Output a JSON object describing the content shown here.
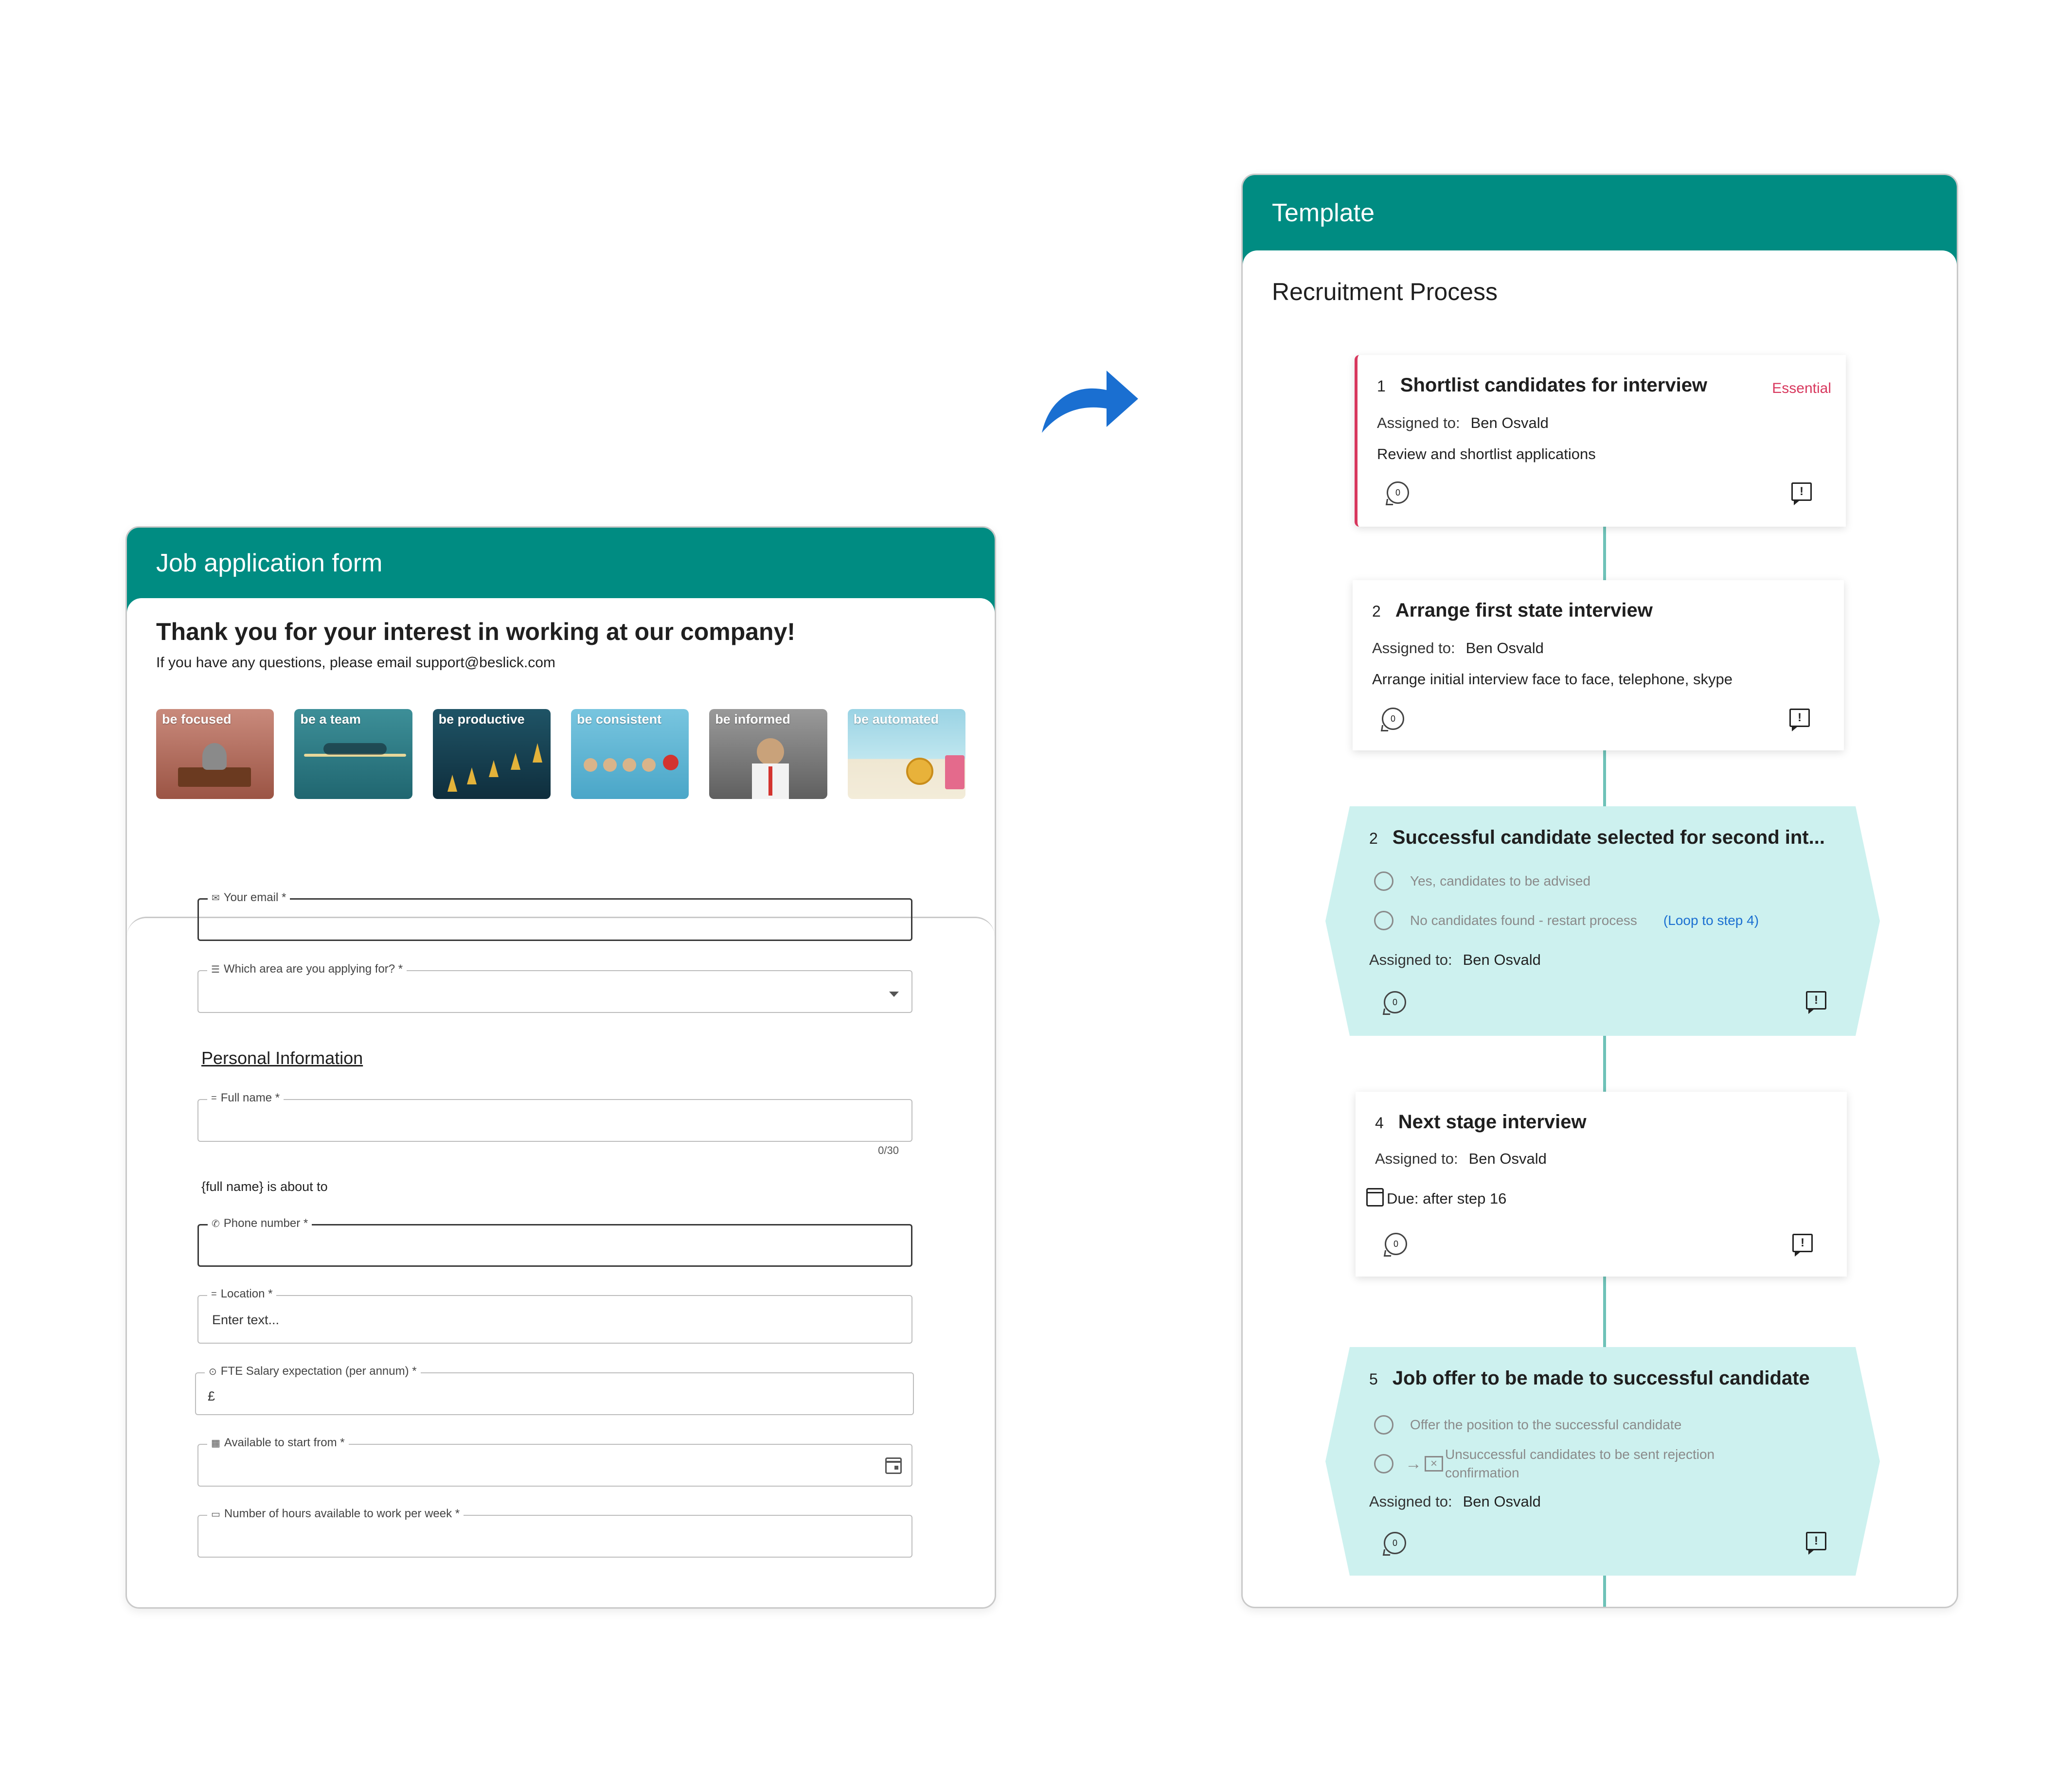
{
  "form": {
    "header": "Job application form",
    "intro_title": "Thank you for your interest in working at our company!",
    "intro_sub": "If you have any questions, please email support@beslick.com",
    "tiles": [
      {
        "label": "be focused",
        "color": "#b56a5c"
      },
      {
        "label": "be a team",
        "color": "#2d7c86"
      },
      {
        "label": "be productive",
        "color": "#153f52"
      },
      {
        "label": "be consistent",
        "color": "#5ab3d2"
      },
      {
        "label": "be informed",
        "color": "#7f7f7f"
      },
      {
        "label": "be automated",
        "color": "#9ad3e4"
      }
    ],
    "fields": {
      "email_label": "Your email *",
      "area_label": "Which area are you applying for? *",
      "personal_heading": "Personal Information",
      "fullname_label": "Full name *",
      "fullname_counter": "0/30",
      "helper_text": "{full name} is about to",
      "phone_label": "Phone number *",
      "location_label": "Location *",
      "location_placeholder": "Enter text...",
      "salary_label": "FTE Salary expectation (per annum) *",
      "salary_value": "£",
      "start_label": "Available to start from *",
      "hours_label": "Number of hours available to work per week *"
    }
  },
  "template": {
    "header": "Template",
    "process_title": "Recruitment Process",
    "assigned_label": "Assigned to:",
    "steps": [
      {
        "num": "1",
        "title": "Shortlist candidates for interview",
        "badge": "Essential",
        "assignee": "Ben Osvald",
        "desc": "Review and shortlist applications",
        "comments": "0"
      },
      {
        "num": "2",
        "title": "Arrange first state interview",
        "assignee": "Ben Osvald",
        "desc": "Arrange initial interview face to face, telephone, skype",
        "comments": "0"
      },
      {
        "num": "2",
        "title": "Successful candidate selected for second int...",
        "options": [
          "Yes, candidates to be advised",
          "No candidates found - restart process"
        ],
        "loop_link": "(Loop to step 4)",
        "assignee": "Ben Osvald",
        "comments": "0"
      },
      {
        "num": "4",
        "title": "Next stage interview",
        "assignee": "Ben Osvald",
        "due": "Due: after step 16",
        "comments": "0"
      },
      {
        "num": "5",
        "title": "Job offer to be made to successful candidate",
        "options": [
          "Offer the position to the successful candidate",
          "Unsuccessful candidates to be sent rejection confirmation"
        ],
        "assignee": "Ben Osvald",
        "comments": "0"
      }
    ]
  },
  "colors": {
    "header": "#008c82",
    "essential": "#d8385e",
    "decision_fill": "#cdf1ef",
    "connector": "#6ec2b8",
    "arrow": "#1a6fd1"
  }
}
